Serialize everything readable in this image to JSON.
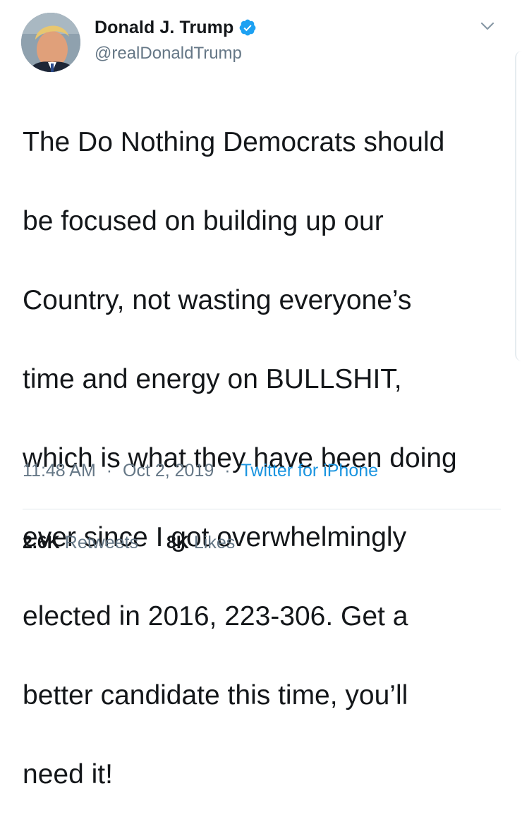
{
  "user": {
    "display_name": "Donald J. Trump",
    "handle": "@realDonaldTrump",
    "verified": true,
    "avatar_icon": "profile-photo"
  },
  "tweet": {
    "lines": [
      "The Do Nothing Democrats should",
      "be focused on building up our",
      "Country, not wasting everyone’s",
      "time and energy on BULLSHIT,",
      "which is what they have been doing",
      "ever since I got overwhelmingly",
      "elected in 2016, 223-306. Get a",
      "better candidate this time, you’ll",
      "need it!"
    ]
  },
  "meta": {
    "time": "11:48 AM",
    "separator": "·",
    "date": "Oct 2, 2019",
    "source": "Twitter for iPhone"
  },
  "stats": {
    "retweets_count": "2.6K",
    "retweets_label": "Retweets",
    "likes_count": "8K",
    "likes_label": "Likes"
  },
  "colors": {
    "text": "#14171a",
    "secondary": "#657786",
    "link": "#1b95e0",
    "verified": "#1da1f2",
    "divider": "#e1e8ed"
  },
  "icons": {
    "verified": "verified-badge-icon",
    "menu": "chevron-down-icon"
  }
}
